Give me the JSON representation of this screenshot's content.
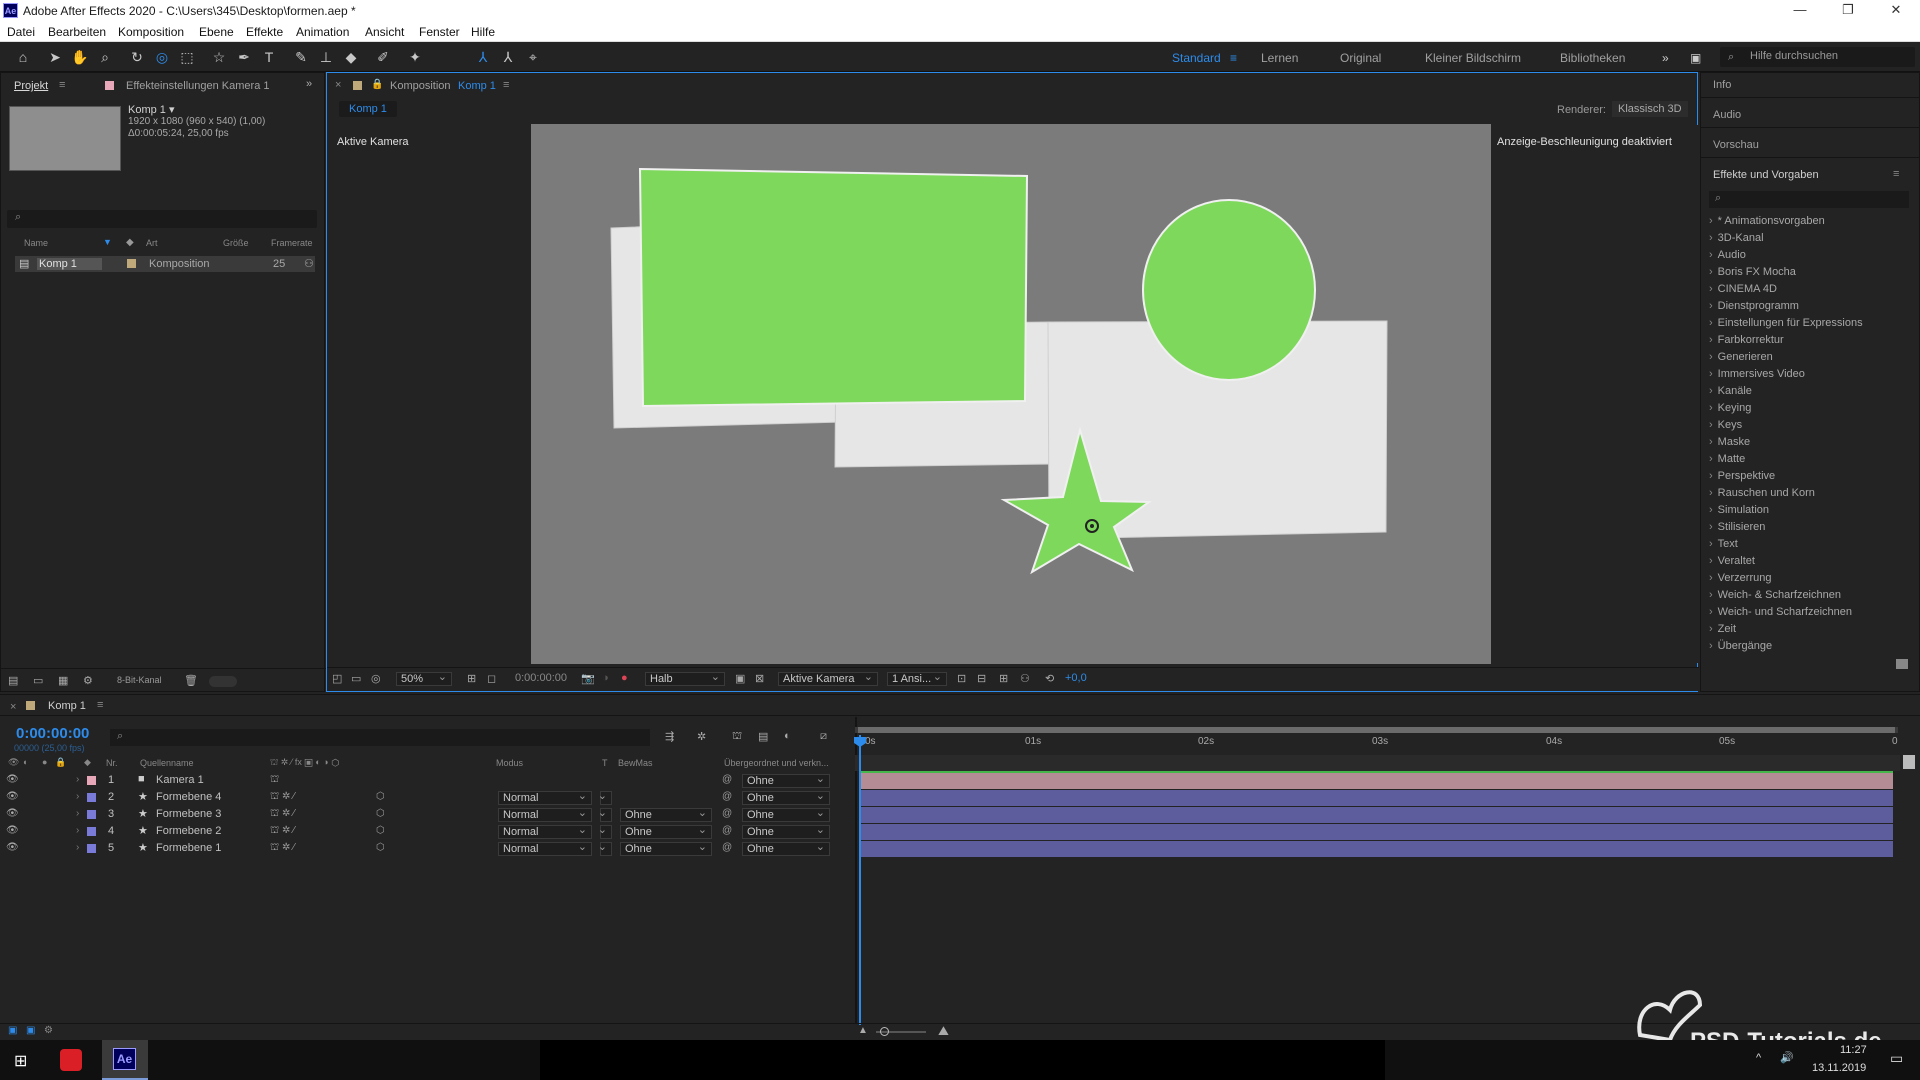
{
  "titlebar": {
    "app_icon": "Ae",
    "title": "Adobe After Effects 2020 - C:\\Users\\345\\Desktop\\formen.aep *"
  },
  "menu": [
    "Datei",
    "Bearbeiten",
    "Komposition",
    "Ebene",
    "Effekte",
    "Animation",
    "Ansicht",
    "Fenster",
    "Hilfe"
  ],
  "workspaces": {
    "active": "Standard",
    "items": [
      "Lernen",
      "Original",
      "Kleiner Bildschirm",
      "Bibliotheken"
    ],
    "help_placeholder": "Hilfe durchsuchen"
  },
  "project": {
    "tabs": [
      "Projekt",
      "Effekteinstellungen Kamera 1"
    ],
    "comp_name": "Komp 1 ▾",
    "comp_info1": "1920 x 1080 (960 x 540) (1,00)",
    "comp_info2": "Δ0:00:05:24, 25,00 fps",
    "columns": [
      "Name",
      "Art",
      "Größe",
      "Framerate"
    ],
    "row": {
      "name": "Komp 1",
      "type": "Komposition",
      "fps": "25"
    },
    "bit_depth": "8-Bit-Kanal"
  },
  "composition": {
    "tab_prefix": "Komposition",
    "tab_name": "Komp 1",
    "subtab": "Komp 1",
    "renderer_label": "Renderer:",
    "renderer_value": "Klassisch 3D",
    "camera_label": "Aktive Kamera",
    "accel_note": "Anzeige-Beschleunigung deaktiviert",
    "shape_color": "#7ed85c",
    "card_color": "#e6e6e6",
    "viewer_bg": "#7b7b7b",
    "bar": {
      "zoom": "50%",
      "time": "0:00:00:00",
      "quality": "Halb",
      "camera": "Aktive Kamera",
      "views": "1 Ansi...",
      "exposure": "+0,0"
    }
  },
  "effects_panel": {
    "sections": [
      "Info",
      "Audio",
      "Vorschau",
      "Effekte und Vorgaben"
    ],
    "items": [
      "* Animationsvorgaben",
      "3D-Kanal",
      "Audio",
      "Boris FX Mocha",
      "CINEMA 4D",
      "Dienstprogramm",
      "Einstellungen für Expressions",
      "Farbkorrektur",
      "Generieren",
      "Immersives Video",
      "Kanäle",
      "Keying",
      "Keys",
      "Maske",
      "Matte",
      "Perspektive",
      "Rauschen und Korn",
      "Simulation",
      "Stilisieren",
      "Text",
      "Veraltet",
      "Verzerrung",
      "Weich- & Scharfzeichnen",
      "Weich- und Scharfzeichnen",
      "Zeit",
      "Übergänge"
    ]
  },
  "timeline": {
    "tab": "Komp 1",
    "timecode": "0:00:00:00",
    "timecode_sub": "00000 (25,00 fps)",
    "columns": {
      "nr": "Nr.",
      "source": "Quellenname",
      "mode": "Modus",
      "t": "T",
      "trkmat": "BewMas",
      "parent": "Übergeordnet und verkn..."
    },
    "ruler": [
      "0s",
      "01s",
      "02s",
      "03s",
      "04s",
      "05s",
      "0"
    ],
    "layers": [
      {
        "nr": "1",
        "name": "Kamera 1",
        "label_color": "#e8a7b8",
        "mode": "",
        "trkmat": "",
        "parent": "Ohne",
        "bar_color": "#b38c96"
      },
      {
        "nr": "2",
        "name": "Formebene 4",
        "label_color": "#7a7ad8",
        "mode": "Normal",
        "trkmat": "",
        "parent": "Ohne",
        "bar_color": "#5d5d9e"
      },
      {
        "nr": "3",
        "name": "Formebene 3",
        "label_color": "#7a7ad8",
        "mode": "Normal",
        "trkmat": "Ohne",
        "parent": "Ohne",
        "bar_color": "#5d5d9e"
      },
      {
        "nr": "4",
        "name": "Formebene 2",
        "label_color": "#7a7ad8",
        "mode": "Normal",
        "trkmat": "Ohne",
        "parent": "Ohne",
        "bar_color": "#5d5d9e"
      },
      {
        "nr": "5",
        "name": "Formebene 1",
        "label_color": "#7a7ad8",
        "mode": "Normal",
        "trkmat": "Ohne",
        "parent": "Ohne",
        "bar_color": "#5d5d9e"
      }
    ]
  },
  "watermark": "PSD-Tutorials.de",
  "taskbar": {
    "time": "11:27",
    "date": "13.11.2019"
  },
  "accent": "#2d8ceb"
}
